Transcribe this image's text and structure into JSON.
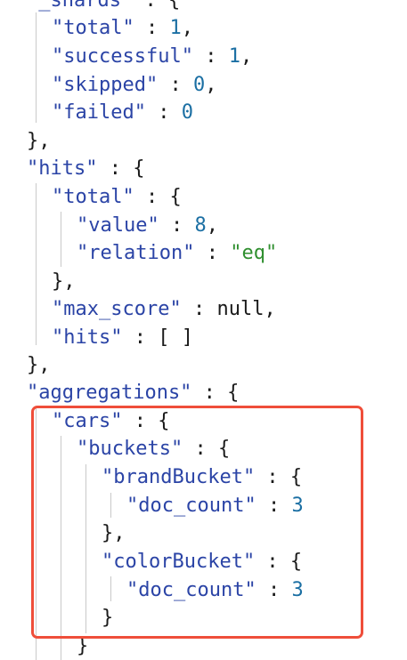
{
  "lines": [
    {
      "parts": [
        {
          "t": "\"_shards\"",
          "c": "key"
        },
        {
          "t": " : {",
          "c": "p"
        }
      ]
    },
    {
      "parts": [
        {
          "t": "\"total\"",
          "c": "key"
        },
        {
          "t": " : ",
          "c": "p"
        },
        {
          "t": "1",
          "c": "num"
        },
        {
          "t": ",",
          "c": "p"
        }
      ]
    },
    {
      "parts": [
        {
          "t": "\"successful\"",
          "c": "key"
        },
        {
          "t": " : ",
          "c": "p"
        },
        {
          "t": "1",
          "c": "num"
        },
        {
          "t": ",",
          "c": "p"
        }
      ]
    },
    {
      "parts": [
        {
          "t": "\"skipped\"",
          "c": "key"
        },
        {
          "t": " : ",
          "c": "p"
        },
        {
          "t": "0",
          "c": "num"
        },
        {
          "t": ",",
          "c": "p"
        }
      ]
    },
    {
      "parts": [
        {
          "t": "\"failed\"",
          "c": "key"
        },
        {
          "t": " : ",
          "c": "p"
        },
        {
          "t": "0",
          "c": "num"
        }
      ]
    },
    {
      "parts": [
        {
          "t": "},",
          "c": "p"
        }
      ]
    },
    {
      "parts": [
        {
          "t": "\"hits\"",
          "c": "key"
        },
        {
          "t": " : {",
          "c": "p"
        }
      ]
    },
    {
      "parts": [
        {
          "t": "\"total\"",
          "c": "key"
        },
        {
          "t": " : {",
          "c": "p"
        }
      ]
    },
    {
      "parts": [
        {
          "t": "\"value\"",
          "c": "key"
        },
        {
          "t": " : ",
          "c": "p"
        },
        {
          "t": "8",
          "c": "num"
        },
        {
          "t": ",",
          "c": "p"
        }
      ]
    },
    {
      "parts": [
        {
          "t": "\"relation\"",
          "c": "key"
        },
        {
          "t": " : ",
          "c": "p"
        },
        {
          "t": "\"eq\"",
          "c": "str"
        }
      ]
    },
    {
      "parts": [
        {
          "t": "},",
          "c": "p"
        }
      ]
    },
    {
      "parts": [
        {
          "t": "\"max_score\"",
          "c": "key"
        },
        {
          "t": " : ",
          "c": "p"
        },
        {
          "t": "null",
          "c": "nul"
        },
        {
          "t": ",",
          "c": "p"
        }
      ]
    },
    {
      "parts": [
        {
          "t": "\"hits\"",
          "c": "key"
        },
        {
          "t": " : [ ]",
          "c": "p"
        }
      ]
    },
    {
      "parts": [
        {
          "t": "},",
          "c": "p"
        }
      ]
    },
    {
      "parts": [
        {
          "t": "\"aggregations\"",
          "c": "key"
        },
        {
          "t": " : {",
          "c": "p"
        }
      ]
    },
    {
      "parts": [
        {
          "t": "\"cars\"",
          "c": "key"
        },
        {
          "t": " : {",
          "c": "p"
        }
      ]
    },
    {
      "parts": [
        {
          "t": "\"buckets\"",
          "c": "key"
        },
        {
          "t": " : {",
          "c": "p"
        }
      ]
    },
    {
      "parts": [
        {
          "t": "\"brandBucket\"",
          "c": "key"
        },
        {
          "t": " : {",
          "c": "p"
        }
      ]
    },
    {
      "parts": [
        {
          "t": "\"doc_count\"",
          "c": "key"
        },
        {
          "t": " : ",
          "c": "p"
        },
        {
          "t": "3",
          "c": "num"
        }
      ]
    },
    {
      "parts": [
        {
          "t": "},",
          "c": "p"
        }
      ]
    },
    {
      "parts": [
        {
          "t": "\"colorBucket\"",
          "c": "key"
        },
        {
          "t": " : {",
          "c": "p"
        }
      ]
    },
    {
      "parts": [
        {
          "t": "\"doc_count\"",
          "c": "key"
        },
        {
          "t": " : ",
          "c": "p"
        },
        {
          "t": "3",
          "c": "num"
        }
      ]
    },
    {
      "parts": [
        {
          "t": "}",
          "c": "p"
        }
      ]
    },
    {
      "parts": [
        {
          "t": "}",
          "c": "p"
        }
      ]
    }
  ],
  "colors": {
    "key": "#2b44a6",
    "number": "#1b6fa3",
    "string": "#2f8f2f",
    "highlight": "#ef4e3a"
  }
}
